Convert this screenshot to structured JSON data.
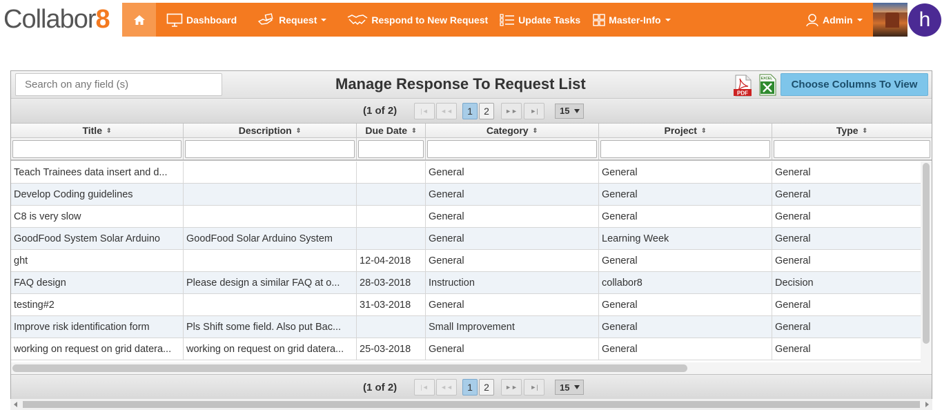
{
  "brand": {
    "logo_text": "Collabor",
    "logo_suffix": "8",
    "accent": "#f47a20"
  },
  "nav": {
    "home_icon": "home-icon",
    "items": [
      {
        "label": "Dashboard",
        "icon": "monitor-icon"
      },
      {
        "label": "Request",
        "icon": "hand-document-icon",
        "dropdown": true
      },
      {
        "label": "Respond to New Request",
        "icon": "handshake-icon"
      },
      {
        "label": "Update Tasks",
        "icon": "checklist-icon"
      },
      {
        "label": "Master-Info",
        "icon": "grid-icon",
        "dropdown": true
      }
    ],
    "user_label": "Admin",
    "user_icon": "user-icon",
    "avatar_letter": "h"
  },
  "grid": {
    "search_placeholder": "Search on any field (s)",
    "title": "Manage Response To Request List",
    "pdf_label": "PDF",
    "excel_label": "EXCEL",
    "choose_columns_label": "Choose Columns To View",
    "pager": {
      "status": "(1 of 2)",
      "pages": [
        "1",
        "2"
      ],
      "current_page": "1",
      "rows_per_page": "15"
    },
    "columns": [
      "Title",
      "Description",
      "Due Date",
      "Category",
      "Project",
      "Type"
    ],
    "rows": [
      [
        "Teach Trainees data insert and d...",
        "",
        "",
        "General",
        "General",
        "General"
      ],
      [
        "Develop Coding guidelines",
        "",
        "",
        "General",
        "General",
        "General"
      ],
      [
        "C8 is very slow",
        "",
        "",
        "General",
        "General",
        "General"
      ],
      [
        "GoodFood System Solar Arduino",
        "GoodFood Solar Arduino System",
        "",
        "General",
        "Learning Week",
        "General"
      ],
      [
        "ght",
        "",
        "12-04-2018",
        "General",
        "General",
        "General"
      ],
      [
        "FAQ design",
        "Please design a similar FAQ at o...",
        "28-03-2018",
        "Instruction",
        "collabor8",
        "Decision"
      ],
      [
        "testing#2",
        "",
        "31-03-2018",
        "General",
        "General",
        "General"
      ],
      [
        "Improve risk identification form",
        "Pls Shift some field. Also put Bac...",
        "",
        "Small Improvement",
        "General",
        "General"
      ],
      [
        "working on request on grid datera...",
        "working on request on grid datera...",
        "25-03-2018",
        "General",
        "General",
        "General"
      ]
    ]
  }
}
